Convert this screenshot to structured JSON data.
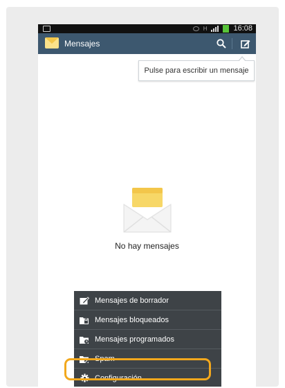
{
  "app": {
    "title": "Mensajes",
    "clock": "16:08"
  },
  "toolbar": {
    "search_icon": "search-icon",
    "compose_icon": "compose-icon"
  },
  "tooltip": {
    "text": "Pulse para escribir un mensaje"
  },
  "empty_state": {
    "icon": "envelope-icon",
    "text": "No hay mensajes"
  },
  "menu": {
    "items": [
      {
        "label": "Mensajes de borrador",
        "icon": "draft-folder-icon"
      },
      {
        "label": "Mensajes bloqueados",
        "icon": "locked-folder-icon"
      },
      {
        "label": "Mensajes programados",
        "icon": "scheduled-folder-icon"
      },
      {
        "label": "Spam",
        "icon": "spam-folder-icon"
      },
      {
        "label": "Configuración",
        "icon": "gear-icon"
      }
    ]
  },
  "colors": {
    "appbar": "#3d586f",
    "menu_bg": "#3e4347",
    "highlight": "#f2a81d",
    "battery": "#58c43a"
  }
}
